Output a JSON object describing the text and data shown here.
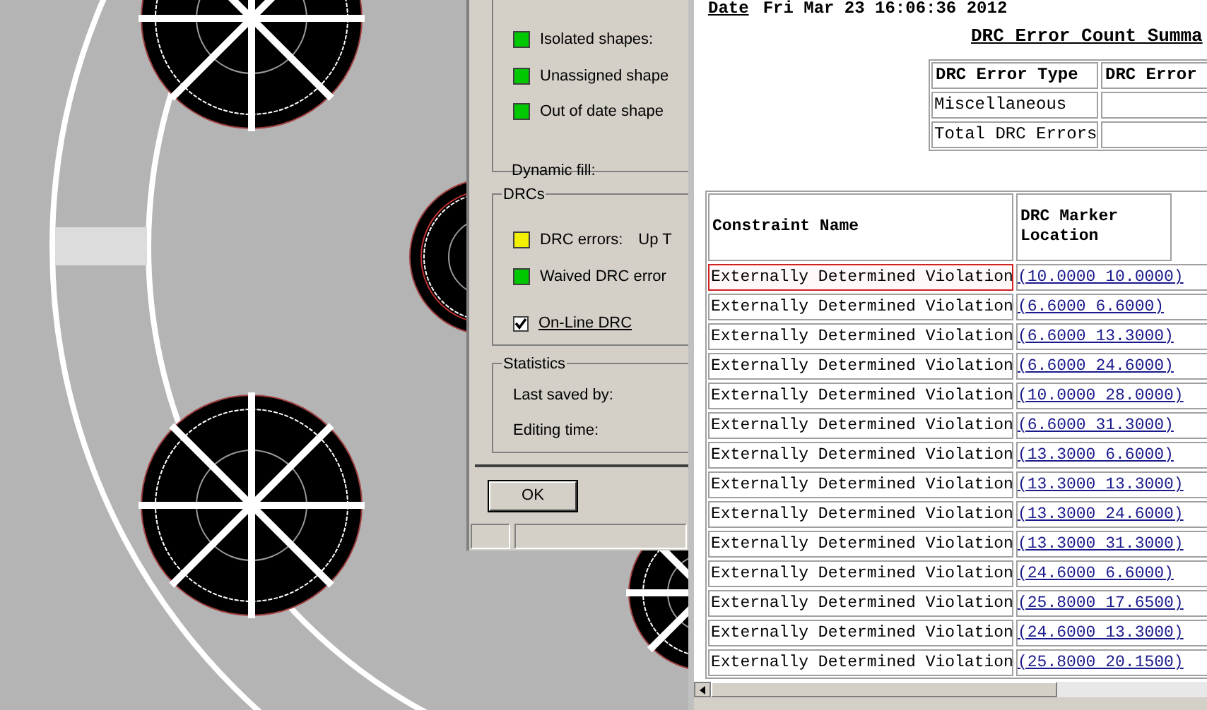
{
  "dialog": {
    "shape_items": [
      {
        "label": "Isolated shapes:",
        "color": "#00c800"
      },
      {
        "label": "Unassigned shape",
        "color": "#00c800"
      },
      {
        "label": "Out of date shape",
        "color": "#00c800"
      }
    ],
    "dynamic_fill_label": "Dynamic fill:",
    "drcs_group": {
      "title": "DRCs",
      "items": [
        {
          "label": "DRC errors:",
          "value": "Up T",
          "color": "#f0f000"
        },
        {
          "label": "Waived DRC error",
          "color": "#00c800"
        }
      ],
      "online_drc": {
        "label": "On-Line DRC",
        "checked": true
      }
    },
    "statistics_group": {
      "title": "Statistics",
      "fields": [
        "Last saved by:",
        "Editing time:"
      ]
    },
    "ok_button": "OK"
  },
  "report": {
    "date_label": "Date",
    "date_value": "Fri Mar 23 16:06:36 2012",
    "summary_title": "DRC Error Count Summa",
    "summary_table": {
      "columns": [
        "DRC Error Type",
        "DRC Error"
      ],
      "rows": [
        "Miscellaneous",
        "Total DRC Errors"
      ]
    },
    "violations_table": {
      "columns": [
        "Constraint Name",
        "DRC Marker Location"
      ],
      "rows": [
        {
          "constraint": "Externally Determined Violation",
          "location": "(10.0000 10.0000)",
          "highlighted": true
        },
        {
          "constraint": "Externally Determined Violation",
          "location": "(6.6000 6.6000)",
          "highlighted": false
        },
        {
          "constraint": "Externally Determined Violation",
          "location": "(6.6000 13.3000)",
          "highlighted": false
        },
        {
          "constraint": "Externally Determined Violation",
          "location": "(6.6000 24.6000)",
          "highlighted": false
        },
        {
          "constraint": "Externally Determined Violation",
          "location": "(10.0000 28.0000)",
          "highlighted": false
        },
        {
          "constraint": "Externally Determined Violation",
          "location": "(6.6000 31.3000)",
          "highlighted": false
        },
        {
          "constraint": "Externally Determined Violation",
          "location": "(13.3000 6.6000)",
          "highlighted": false
        },
        {
          "constraint": "Externally Determined Violation",
          "location": "(13.3000 13.3000)",
          "highlighted": false
        },
        {
          "constraint": "Externally Determined Violation",
          "location": "(13.3000 24.6000)",
          "highlighted": false
        },
        {
          "constraint": "Externally Determined Violation",
          "location": "(13.3000 31.3000)",
          "highlighted": false
        },
        {
          "constraint": "Externally Determined Violation",
          "location": "(24.6000 6.6000)",
          "highlighted": false
        },
        {
          "constraint": "Externally Determined Violation",
          "location": "(25.8000 17.6500)",
          "highlighted": false
        },
        {
          "constraint": "Externally Determined Violation",
          "location": "(24.6000 13.3000)",
          "highlighted": false
        },
        {
          "constraint": "Externally Determined Violation",
          "location": "(25.8000 20.1500)",
          "highlighted": false
        }
      ]
    }
  }
}
